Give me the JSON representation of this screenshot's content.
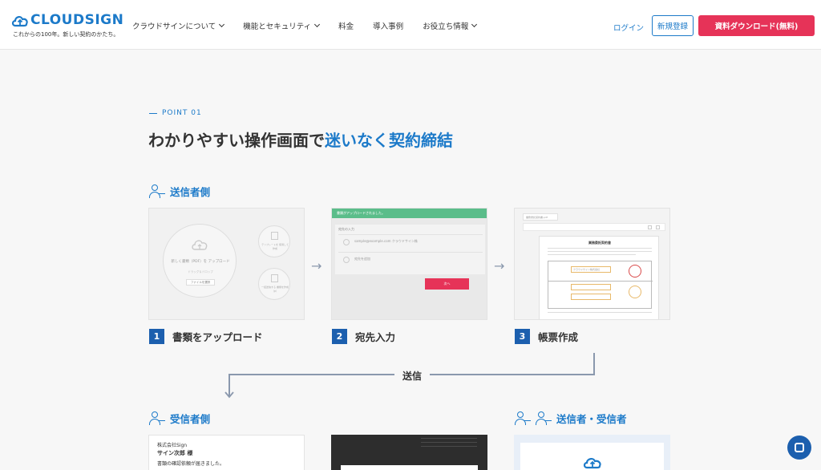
{
  "header": {
    "logo_text_a": "CLOUD",
    "logo_text_b": "SIGN",
    "logo_tagline": "これからの100年。新しい契約のかたち。",
    "nav": [
      {
        "label": "クラウドサインについて",
        "dropdown": true
      },
      {
        "label": "機能とセキュリティ",
        "dropdown": true
      },
      {
        "label": "料金",
        "dropdown": false
      },
      {
        "label": "導入事例",
        "dropdown": false
      },
      {
        "label": "お役立ち情報",
        "dropdown": true
      }
    ],
    "login_label": "ログイン",
    "signup_label": "新規登録",
    "download_label": "資料ダウンロード(無料)"
  },
  "section": {
    "point_label": "POINT 01",
    "heading_plain": "わかりやすい操作画面で",
    "heading_highlight": "迷いなく契約締結"
  },
  "sender_role": "送信者側",
  "receiver_role": "受信者側",
  "both_role": "送信者・受信者",
  "steps": [
    {
      "num": "1",
      "label": "書類をアップロード"
    },
    {
      "num": "2",
      "label": "宛先入力"
    },
    {
      "num": "3",
      "label": "帳票作成"
    }
  ],
  "send_label": "送信",
  "card1": {
    "upload_text": "新しく書類（PDF）を アップロード",
    "upload_sub": "ドラッグ＆ドロップ",
    "upload_button": "ファイルを選択",
    "side_top": "テンプレートを 使用して作成",
    "side_bottom": "一括送信する 書類を作成（β）"
  },
  "card2": {
    "banner": "書類がアップロードされました。",
    "section_title": "宛先の入力",
    "row1": "sample@example.com  クラウドサイン株",
    "row2": "宛先を追加",
    "next_button": "次へ"
  },
  "card3": {
    "tab": "業務委託契約書.pdf",
    "doc_title": "業務委託契約書",
    "field_company": "クラウドサイン株式会社"
  },
  "receiver_card": {
    "company": "株式会社Sign",
    "name": "サイン次郎 様",
    "message": "書類の確認依頼が届きました。"
  },
  "colors": {
    "accent": "#1c7ac9",
    "brand_red": "#e63358",
    "step_blue": "#1c5fae",
    "flow_gray": "#8a98ad",
    "banner_green": "#5bbd8a"
  }
}
